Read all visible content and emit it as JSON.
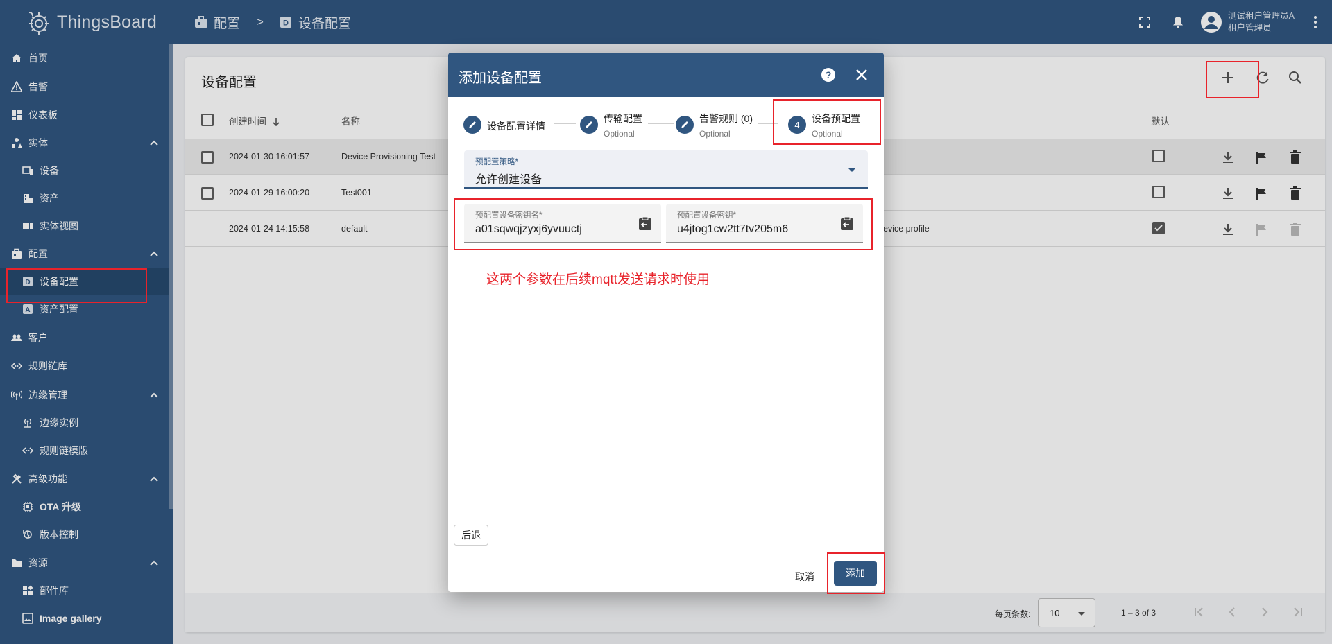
{
  "app": {
    "name": "ThingsBoard"
  },
  "breadcrumb": {
    "parent": "配置",
    "separator": ">",
    "current": "设备配置"
  },
  "user": {
    "name": "测试租户管理员A",
    "role": "租户管理员"
  },
  "sidebar": {
    "items": [
      {
        "label": "首页",
        "icon": "home-icon"
      },
      {
        "label": "告警",
        "icon": "alarm-icon"
      },
      {
        "label": "仪表板",
        "icon": "dashboard-icon"
      },
      {
        "label": "实体",
        "icon": "entity-icon"
      },
      {
        "label": "设备",
        "icon": "device-icon"
      },
      {
        "label": "资产",
        "icon": "asset-icon"
      },
      {
        "label": "实体视图",
        "icon": "entity-view-icon"
      },
      {
        "label": "配置",
        "icon": "profile-icon"
      },
      {
        "label": "设备配置",
        "icon": "device-profile-icon"
      },
      {
        "label": "资产配置",
        "icon": "asset-profile-icon"
      },
      {
        "label": "客户",
        "icon": "customers-icon"
      },
      {
        "label": "规则链库",
        "icon": "rule-chain-icon"
      },
      {
        "label": "边缘管理",
        "icon": "edge-icon"
      },
      {
        "label": "边缘实例",
        "icon": "edge-instance-icon"
      },
      {
        "label": "规则链模版",
        "icon": "rule-template-icon"
      },
      {
        "label": "高级功能",
        "icon": "advanced-icon"
      },
      {
        "label": "OTA 升级",
        "icon": "ota-icon"
      },
      {
        "label": "版本控制",
        "icon": "version-control-icon"
      },
      {
        "label": "资源",
        "icon": "folder-icon"
      },
      {
        "label": "部件库",
        "icon": "widgets-icon"
      },
      {
        "label": "Image gallery",
        "icon": "image-icon"
      }
    ]
  },
  "page": {
    "title": "设备配置"
  },
  "table": {
    "headers": {
      "created": "创建时间",
      "name": "名称",
      "default": "默认"
    },
    "rows": [
      {
        "created": "2024-01-30 16:01:57",
        "name": "Device Provisioning Test",
        "description": "",
        "default": false
      },
      {
        "created": "2024-01-29 16:00:20",
        "name": "Test001",
        "description": "",
        "default": false
      },
      {
        "created": "2024-01-24 14:15:58",
        "name": "default",
        "description": "evice profile",
        "default": true
      }
    ]
  },
  "pagination": {
    "per_page_label": "每页条数:",
    "per_page": "10",
    "range": "1 – 3 of 3"
  },
  "dialog": {
    "title": "添加设备配置",
    "steps": [
      {
        "index": "1",
        "label": "设备配置详情",
        "optional": ""
      },
      {
        "index": "2",
        "label": "传输配置",
        "optional": "Optional"
      },
      {
        "index": "3",
        "label": "告警规则 (0)",
        "optional": "Optional"
      },
      {
        "index": "4",
        "label": "设备预配置",
        "optional": "Optional"
      }
    ],
    "strategy": {
      "label": "预配置策略*",
      "value": "允许创建设备"
    },
    "key_field": {
      "label": "预配置设备密钥名*",
      "value": "a01sqwqjzyxj6yvuuctj"
    },
    "secret_field": {
      "label": "预配置设备密钥*",
      "value": "u4jtog1cw2tt7tv205m6"
    },
    "back_label": "后退",
    "cancel_label": "取消",
    "add_label": "添加"
  },
  "annotation": {
    "text": "这两个参数在后续mqtt发送请求时使用",
    "color": "#e8232b"
  },
  "colors": {
    "primary": "#305680",
    "sidebar_active": "#26496e",
    "annotation_red": "#e8232b"
  }
}
